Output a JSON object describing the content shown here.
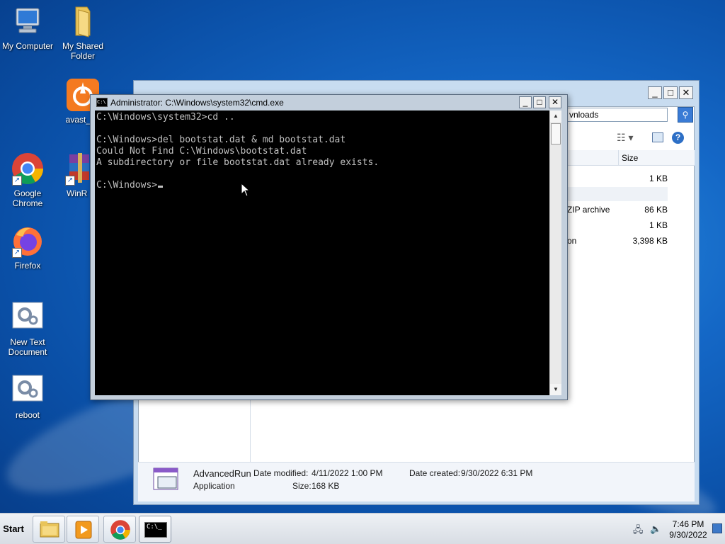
{
  "desktop": {
    "icons": [
      {
        "label": "My Computer",
        "icon": "computer-icon"
      },
      {
        "label": "My Shared Folder",
        "icon": "folder-icon"
      },
      {
        "label": "avast_on",
        "icon": "avast-icon"
      },
      {
        "label": "Google Chrome",
        "icon": "chrome-icon"
      },
      {
        "label": "WinR",
        "icon": "winrar-icon"
      },
      {
        "label": "Firefox",
        "icon": "firefox-icon"
      },
      {
        "label": "New Text Document",
        "icon": "settings-file-icon"
      },
      {
        "label": "reboot",
        "icon": "settings-file-icon"
      }
    ]
  },
  "explorer": {
    "address_fragment": "vnloads",
    "column_size": "Size",
    "rows": [
      {
        "type": "",
        "size": "1 KB"
      },
      {
        "type": "",
        "size": ""
      },
      {
        "type": "ZIP archive",
        "size": "86 KB"
      },
      {
        "type": "",
        "size": "1 KB"
      },
      {
        "type": "on",
        "size": "3,398 KB"
      }
    ],
    "details": {
      "name": "AdvancedRun",
      "kind": "Application",
      "modified_label": "Date modified:",
      "modified_value": "4/11/2022 1:00 PM",
      "created_label": "Date created:",
      "created_value": "9/30/2022 6:31 PM",
      "size_label": "Size:",
      "size_value": "168 KB"
    }
  },
  "cmd": {
    "title": "Administrator: C:\\Windows\\system32\\cmd.exe",
    "icon_text": "C:\\",
    "lines": [
      "C:\\Windows\\system32>cd ..",
      "",
      "C:\\Windows>del bootstat.dat & md bootstat.dat",
      "Could Not Find C:\\Windows\\bootstat.dat",
      "A subdirectory or file bootstat.dat already exists.",
      ""
    ],
    "prompt": "C:\\Windows>"
  },
  "taskbar": {
    "start_label": "Start",
    "pinned": [
      "explorer-icon",
      "media-player-icon",
      "chrome-icon",
      "cmd-icon"
    ],
    "active": "cmd-icon"
  },
  "tray": {
    "time": "7:46 PM",
    "date": "9/30/2022"
  }
}
